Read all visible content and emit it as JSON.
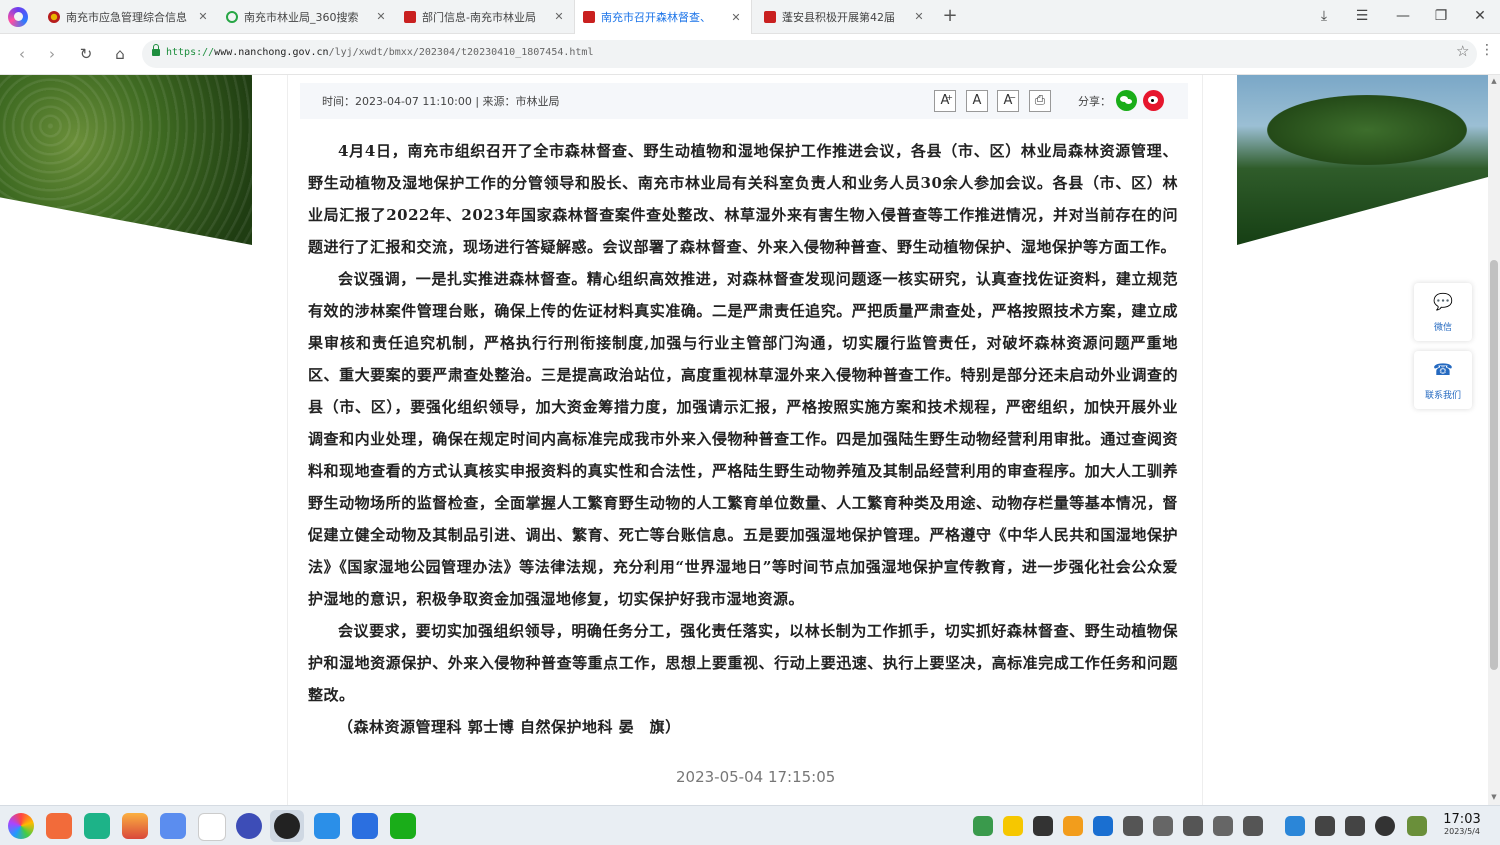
{
  "browser": {
    "tabs": [
      {
        "title": "南充市应急管理综合信息",
        "active": false
      },
      {
        "title": "南充市林业局_360搜索",
        "active": false
      },
      {
        "title": "部门信息-南充市林业局",
        "active": false
      },
      {
        "title": "南充市召开森林督查、",
        "active": true
      },
      {
        "title": "蓬安县积极开展第42届",
        "active": false
      }
    ],
    "new_tab": "+",
    "url_scheme": "https://",
    "url_host": "www.nanchong.gov.cn",
    "url_path": "/lyj/xwdt/bmxx/202304/t20230410_1807454.html"
  },
  "article": {
    "meta": "时间：2023-04-07 11:10:00 | 来源：市林业局",
    "font_buttons": [
      "A",
      "A",
      "A"
    ],
    "share_label": "分享：",
    "paragraphs": [
      "4月4日，南充市组织召开了全市森林督查、野生动植物和湿地保护工作推进会议，各县（市、区）林业局森林资源管理、野生动植物及湿地保护工作的分管领导和股长、南充市林业局有关科室负责人和业务人员30余人参加会议。各县（市、区）林业局汇报了2022年、2023年国家森林督查案件查处整改、林草湿外来有害生物入侵普查等工作推进情况，并对当前存在的问题进行了汇报和交流，现场进行答疑解惑。会议部署了森林督查、外来入侵物种普查、野生动植物保护、湿地保护等方面工作。",
      "会议强调，一是扎实推进森林督查。精心组织高效推进，对森林督查发现问题逐一核实研究，认真查找佐证资料，建立规范有效的涉林案件管理台账，确保上传的佐证材料真实准确。二是严肃责任追究。严把质量严肃查处，严格按照技术方案，建立成果审核和责任追究机制，严格执行行刑衔接制度,加强与行业主管部门沟通，切实履行监管责任，对破坏森林资源问题严重地区、重大要案的要严肃查处整治。三是提高政治站位，高度重视林草湿外来入侵物种普查工作。特别是部分还未启动外业调查的县（市、区），要强化组织领导，加大资金筹措力度，加强请示汇报，严格按照实施方案和技术规程，严密组织，加快开展外业调查和内业处理，确保在规定时间内高标准完成我市外来入侵物种普查工作。四是加强陆生野生动物经营利用审批。通过查阅资料和现地查看的方式认真核实申报资料的真实性和合法性，严格陆生野生动物养殖及其制品经营利用的审查程序。加大人工驯养野生动物场所的监督检查，全面掌握人工繁育野生动物的人工繁育单位数量、人工繁育种类及用途、动物存栏量等基本情况，督促建立健全动物及其制品引进、调出、繁育、死亡等台账信息。五是要加强湿地保护管理。严格遵守《中华人民共和国湿地保护法》《国家湿地公园管理办法》等法律法规，充分利用“世界湿地日”等时间节点加强湿地保护宣传教育，进一步强化社会公众爱护湿地的意识，积极争取资金加强湿地修复，切实保护好我市湿地资源。",
      "会议要求，要切实加强组织领导，明确任务分工，强化责任落实，以林长制为工作抓手，切实抓好森林督查、野生动植物保护和湿地资源保护、外来入侵物种普查等重点工作，思想上要重视、行动上要迅速、执行上要坚决，高标准完成工作任务和问题整改。"
    ],
    "author": "（森林资源管理科 郭士博 自然保护地科 晏　旗）"
  },
  "side_float": {
    "wechat_label": "微信",
    "contact_label": "联系我们"
  },
  "overlay_timestamp": "2023-05-04 17:15:05",
  "taskbar": {
    "clock_time": "17:03",
    "clock_date": "2023/5/4"
  },
  "colors": {
    "accent": "#1a73e8",
    "tab_favicon_red": "#c9201f",
    "side_float_blue": "#2469c0",
    "wechat_green": "#1aad19",
    "weibo_red": "#e6162d"
  }
}
